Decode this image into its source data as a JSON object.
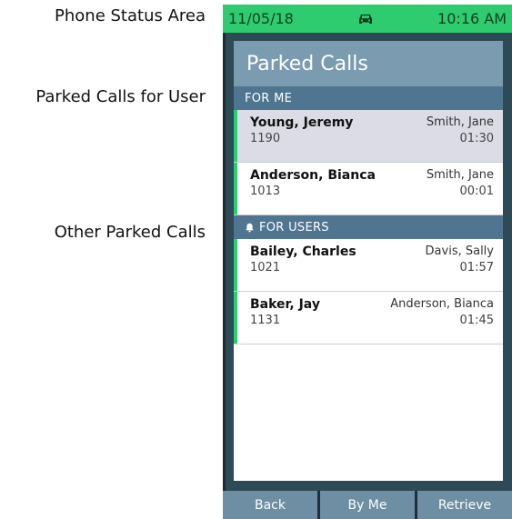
{
  "annotations": {
    "phone_status": "Phone Status Area",
    "parked_for_user": "Parked Calls for User",
    "other_parked": "Other Parked Calls"
  },
  "status_bar": {
    "date": "11/05/18",
    "icon": "car-icon",
    "time": "10:16 AM",
    "color": "#2ecc6f"
  },
  "screen": {
    "title": "Parked Calls",
    "sections": {
      "for_me": {
        "header": "FOR ME",
        "calls": [
          {
            "caller": "Young, Jeremy",
            "extension": "1190",
            "parked_by": "Smith, Jane",
            "duration": "01:30",
            "selected": true
          },
          {
            "caller": "Anderson, Bianca",
            "extension": "1013",
            "parked_by": "Smith, Jane",
            "duration": "00:01",
            "selected": false
          }
        ]
      },
      "for_users": {
        "header": "FOR USERS",
        "icon": "bell-icon",
        "calls": [
          {
            "caller": "Bailey, Charles",
            "extension": "1021",
            "parked_by": "Davis, Sally",
            "duration": "01:57"
          },
          {
            "caller": "Baker, Jay",
            "extension": "1131",
            "parked_by": "Anderson, Bianca",
            "duration": "01:45"
          }
        ]
      }
    }
  },
  "softkeys": {
    "back": "Back",
    "by_me": "By Me",
    "retrieve": "Retrieve"
  },
  "colors": {
    "accent": "#27d06a",
    "title_bar": "#7b9bb0",
    "section_header": "#4f7590",
    "selected_row": "#dcdce6",
    "softkey": "#6d8ea3"
  }
}
